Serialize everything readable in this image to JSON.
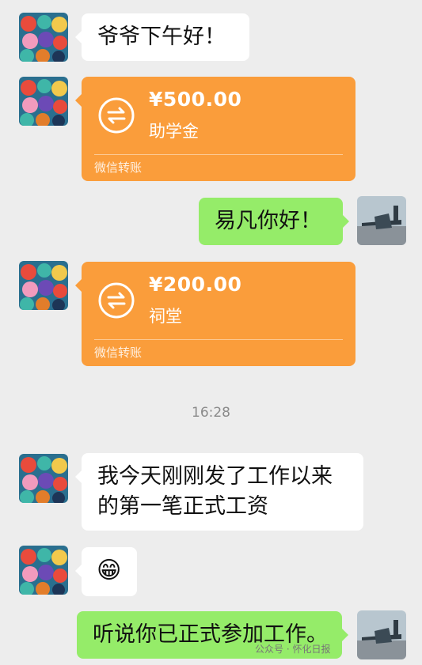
{
  "messages": {
    "m1": {
      "text": "爷爷下午好！"
    },
    "t1": {
      "amount": "¥500.00",
      "note": "助学金",
      "footer": "微信转账",
      "icon": "transfer-arrows-icon"
    },
    "m2": {
      "text": "易凡你好！"
    },
    "t2": {
      "amount": "¥200.00",
      "note": "祠堂",
      "footer": "微信转账",
      "icon": "transfer-arrows-icon"
    },
    "time": "16:28",
    "m3": {
      "line1": "我今天刚刚发了工作以来",
      "line2": "的第一笔正式工资"
    },
    "m4": {
      "emoji": "😁"
    },
    "m5": {
      "text": "听说你已正式参加工作。"
    }
  },
  "watermark": {
    "text": "公众号 · 怀化日报",
    "brand": "怀化日报"
  },
  "colors": {
    "background": "#ededed",
    "sent_bubble": "#95ec69",
    "received_bubble": "#ffffff",
    "transfer": "#fa9d3b"
  }
}
